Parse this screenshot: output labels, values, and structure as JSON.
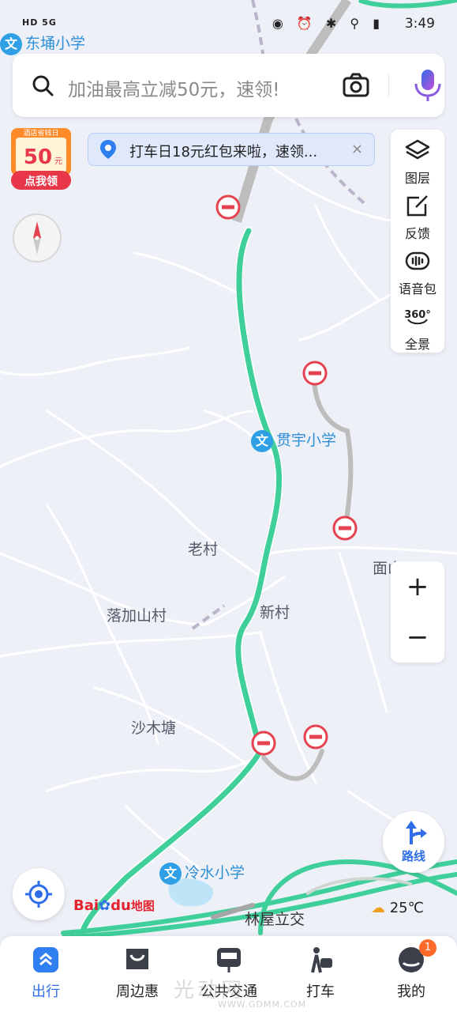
{
  "status_bar": {
    "left_text": "HD 5G ",
    "time": "3:49",
    "right_icons": "◉ ⏰ ✱ ⚲ ▮"
  },
  "search": {
    "placeholder": "加油最高立减50元，速领!"
  },
  "promo_badge": {
    "top_text": "酒店省钱日",
    "amount": "50",
    "unit": "元",
    "button": "点我领"
  },
  "notice": {
    "text": "打车日18元红包来啦，速领...",
    "close": "×"
  },
  "right_panel": {
    "items": [
      {
        "label": "图层",
        "icon": "layers-icon"
      },
      {
        "label": "反馈",
        "icon": "feedback-icon"
      },
      {
        "label": "语音包",
        "icon": "voice-pack-icon"
      },
      {
        "label": "全景",
        "icon": "panorama-360-icon",
        "icon_text": "360°"
      }
    ]
  },
  "zoom": {
    "in": "+",
    "out": "−"
  },
  "route_button": {
    "label": "路线"
  },
  "map_labels": {
    "poi_top": "东埇小学",
    "poi_mid": "贯宇小学",
    "poi_bottom": "冷水小学",
    "laocun": "老村",
    "luojia": "落加山村",
    "xincun": "新村",
    "shamutang": "沙木塘",
    "mianshan": "面山園",
    "linwu": "林屋立交"
  },
  "poi_badge": "文",
  "brand": {
    "bai": "Bai",
    "du": "du",
    "map": "地图"
  },
  "weather": {
    "temp": "25℃"
  },
  "tabs": [
    {
      "label": "出行",
      "icon": "travel-icon",
      "active": true
    },
    {
      "label": "周边惠",
      "icon": "nearby-deals-icon",
      "active": false
    },
    {
      "label": "公共交通",
      "icon": "public-transit-icon",
      "active": false
    },
    {
      "label": "打车",
      "icon": "taxi-icon",
      "active": false
    },
    {
      "label": "我的",
      "icon": "profile-icon",
      "active": false,
      "badge": "1"
    }
  ],
  "watermark": {
    "main": "光动网",
    "sub": "WWW.GDMM.COM"
  },
  "colors": {
    "accent": "#2f6ee8",
    "route": "#3fcf9a",
    "closure": "#e4424f",
    "road": "#ffffff",
    "background": "#eef0f7"
  }
}
